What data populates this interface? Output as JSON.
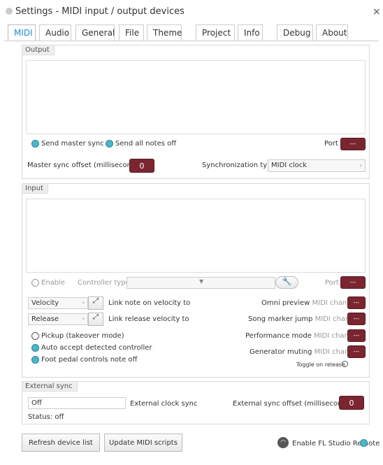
{
  "window": {
    "title": "Settings - MIDI input / output devices",
    "close_label": "×"
  },
  "tabs": [
    "MIDI",
    "Audio",
    "General",
    "File",
    "Theme",
    "Project",
    "Info",
    "Debug",
    "About"
  ],
  "output": {
    "label": "Output",
    "send_master_sync": "Send master sync",
    "send_all_notes_off": "Send all notes off",
    "port_label": "Port",
    "port_value": "---",
    "offset_label": "Master sync offset (milliseconds)",
    "offset_value": "0",
    "sync_type_label": "Synchronization type",
    "sync_type_value": "MIDI clock"
  },
  "input": {
    "label": "Input",
    "enable_label": "Enable",
    "controller_type_label": "Controller type",
    "port_label": "Port",
    "port_value": "---",
    "velocity_select": "Velocity",
    "link_note_label": "Link note on velocity to",
    "release_select": "Release",
    "link_release_label": "Link release velocity to",
    "pickup_label": "Pickup (takeover mode)",
    "auto_accept_label": "Auto accept detected controller",
    "foot_pedal_label": "Foot pedal controls note off",
    "omni_preview": "Omni preview",
    "song_marker_jump": "Song marker jump",
    "performance_mode": "Performance mode",
    "generator_muting": "Generator muting",
    "midi_channel": "MIDI channel",
    "channel_value": "---",
    "toggle_on_release": "Toggle on release"
  },
  "external_sync": {
    "label": "External sync",
    "clock_select": "Off",
    "clock_label": "External clock sync",
    "offset_label": "External sync offset (milliseconds)",
    "offset_value": "0",
    "status": "Status: off"
  },
  "footer": {
    "refresh": "Refresh device list",
    "update": "Update MIDI scripts",
    "remote": "Enable FL Studio Remote"
  }
}
